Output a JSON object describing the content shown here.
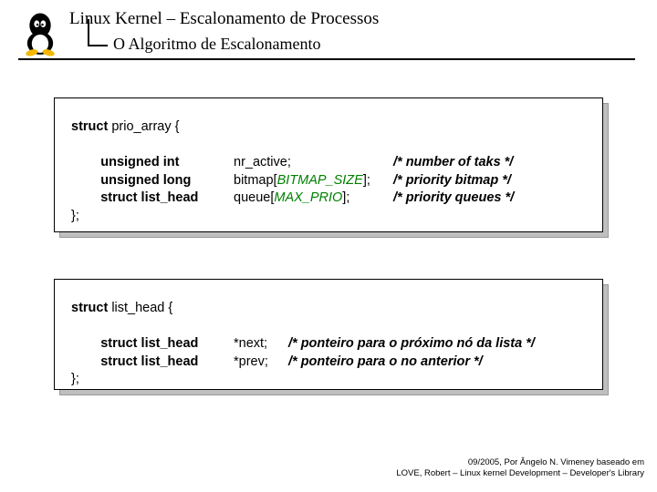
{
  "header": {
    "title": "Linux Kernel – Escalonamento de Processos",
    "subtitle": "O Algoritmo de Escalonamento"
  },
  "box1": {
    "l1": "struct",
    "l1b": " prio_array {",
    "t1": "        unsigned int",
    "t2": "        unsigned long",
    "t3": "        struct list_head",
    "n1": "nr_active;",
    "n2a": "bitmap[",
    "n2b": "BITMAP_SIZE",
    "n2c": "];",
    "n3a": "queue[",
    "n3b": "MAX_PRIO",
    "n3c": "];",
    "c1": "/* number of taks */",
    "c2": "/* priority bitmap */",
    "c3": "/* priority queues */",
    "close": "};"
  },
  "box2": {
    "l1": "struct",
    "l1b": " list_head {",
    "t1": "        struct list_head",
    "t2": "        struct list_head",
    "n1": "*next;",
    "n2": "*prev;",
    "c1": "/* ponteiro para o próximo nó da lista */",
    "c2": "/* ponteiro para o no anterior */",
    "close": "};"
  },
  "footer": {
    "line1": "09/2005, Por Ângelo N. Vimeney baseado em",
    "line2": "LOVE, Robert – Linux kernel Development – Developer's Library"
  }
}
